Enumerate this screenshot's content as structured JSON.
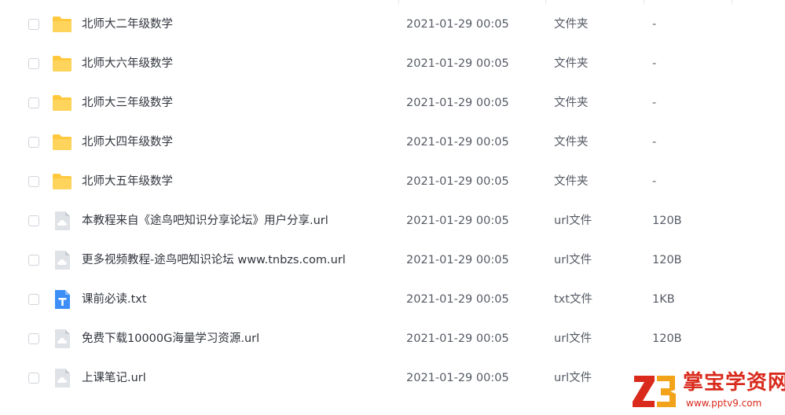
{
  "files": [
    {
      "icon": "folder-icon",
      "name": "北师大二年级数学",
      "date": "2021-01-29 00:05",
      "type": "文件夹",
      "size": "-"
    },
    {
      "icon": "folder-icon",
      "name": "北师大六年级数学",
      "date": "2021-01-29 00:05",
      "type": "文件夹",
      "size": "-"
    },
    {
      "icon": "folder-icon",
      "name": "北师大三年级数学",
      "date": "2021-01-29 00:05",
      "type": "文件夹",
      "size": "-"
    },
    {
      "icon": "folder-icon",
      "name": "北师大四年级数学",
      "date": "2021-01-29 00:05",
      "type": "文件夹",
      "size": "-"
    },
    {
      "icon": "folder-icon",
      "name": "北师大五年级数学",
      "date": "2021-01-29 00:05",
      "type": "文件夹",
      "size": "-"
    },
    {
      "icon": "url-file-icon",
      "name": "本教程来自《途鸟吧知识分享论坛》用户分享.url",
      "date": "2021-01-29 00:05",
      "type": "url文件",
      "size": "120B"
    },
    {
      "icon": "url-file-icon",
      "name": "更多视频教程-途鸟吧知识论坛 www.tnbzs.com.url",
      "date": "2021-01-29 00:05",
      "type": "url文件",
      "size": "120B"
    },
    {
      "icon": "txt-file-icon",
      "name": "课前必读.txt",
      "date": "2021-01-29 00:05",
      "type": "txt文件",
      "size": "1KB"
    },
    {
      "icon": "url-file-icon",
      "name": "免费下载10000G海量学习资源.url",
      "date": "2021-01-29 00:05",
      "type": "url文件",
      "size": "120B"
    },
    {
      "icon": "url-file-icon",
      "name": "上课笔记.url",
      "date": "2021-01-29 00:05",
      "type": "url文件",
      "size": ""
    }
  ],
  "watermark": {
    "title": "掌宝学资网",
    "url": "www.pptv9.com"
  },
  "colors": {
    "folder": "#ffc83d",
    "url_file": "#dfe2e6",
    "txt_file": "#3e8ef7",
    "watermark": "#d92a1c"
  }
}
